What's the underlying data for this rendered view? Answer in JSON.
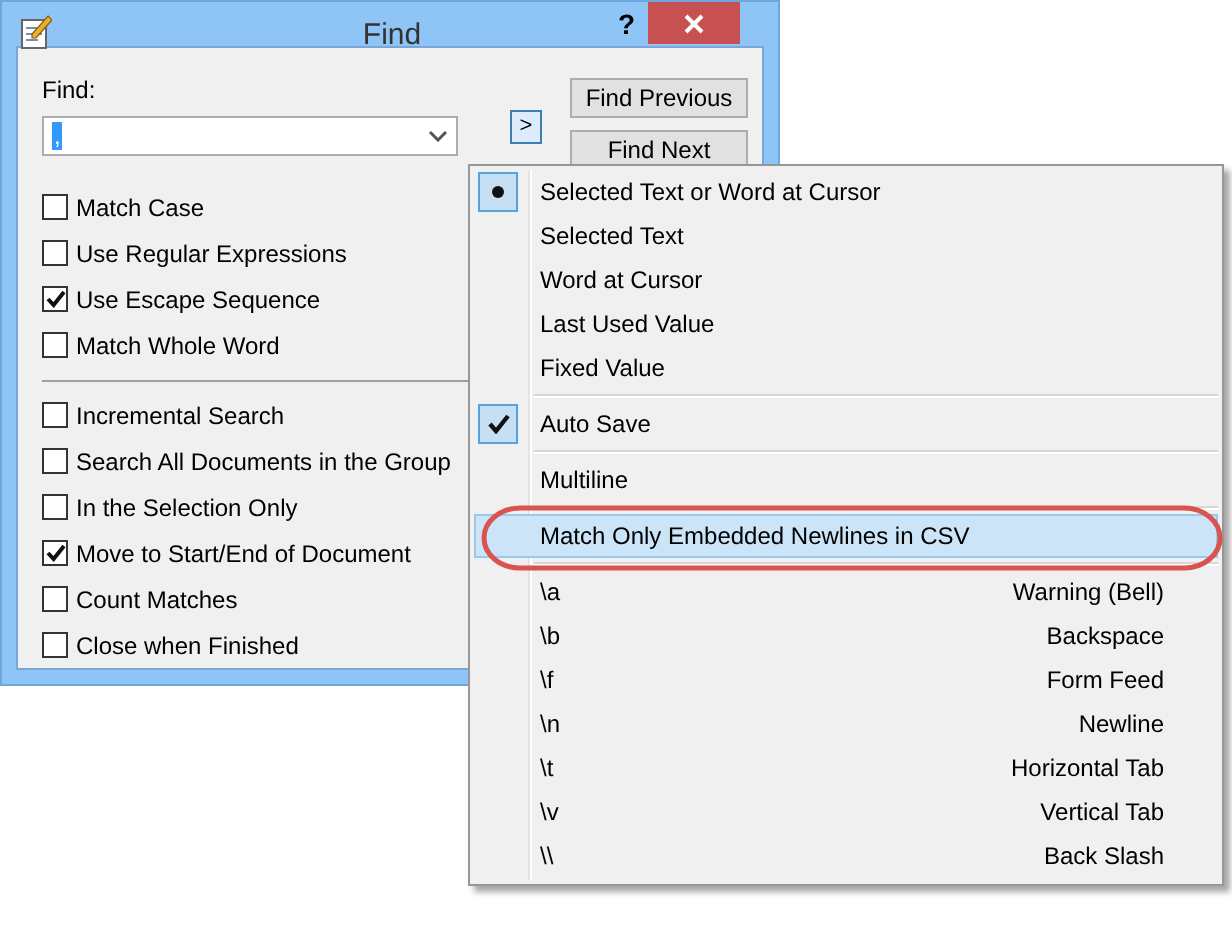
{
  "window": {
    "title": "Find",
    "help": "?"
  },
  "find": {
    "label": "Find:",
    "value": ",",
    "value_selected": true
  },
  "expand_button": {
    "label": ">",
    "pressed": true
  },
  "buttons": [
    {
      "label": "Find Previous"
    },
    {
      "label": "Find Next"
    }
  ],
  "option_groups": [
    [
      {
        "label": "Match Case",
        "checked": false
      },
      {
        "label": "Use Regular Expressions",
        "checked": false
      },
      {
        "label": "Use Escape Sequence",
        "checked": true
      },
      {
        "label": "Match Whole Word",
        "checked": false
      }
    ],
    [
      {
        "label": "Incremental Search",
        "checked": false
      },
      {
        "label": "Search All Documents in the Group",
        "checked": false
      },
      {
        "label": "In the Selection Only",
        "checked": false
      },
      {
        "label": "Move to Start/End of Document",
        "checked": true
      },
      {
        "label": "Count Matches",
        "checked": false
      },
      {
        "label": "Close when Finished",
        "checked": false
      }
    ]
  ],
  "menu": {
    "items": [
      {
        "kind": "radio",
        "label": "Selected Text or Word at Cursor",
        "selected": true
      },
      {
        "kind": "radio",
        "label": "Selected Text",
        "selected": false
      },
      {
        "kind": "radio",
        "label": "Word at Cursor",
        "selected": false
      },
      {
        "kind": "radio",
        "label": "Last Used Value",
        "selected": false
      },
      {
        "kind": "radio",
        "label": "Fixed Value",
        "selected": false
      },
      {
        "kind": "separator"
      },
      {
        "kind": "check",
        "label": "Auto Save",
        "checked": true,
        "highlighted": false,
        "circled": false
      },
      {
        "kind": "separator"
      },
      {
        "kind": "check",
        "label": "Multiline",
        "checked": false,
        "highlighted": false,
        "circled": false
      },
      {
        "kind": "separator"
      },
      {
        "kind": "check",
        "label": "Match Only Embedded Newlines in CSV",
        "checked": false,
        "highlighted": true,
        "circled": true
      },
      {
        "kind": "separator"
      },
      {
        "kind": "escape",
        "code": "\\a",
        "description": "Warning (Bell)"
      },
      {
        "kind": "escape",
        "code": "\\b",
        "description": "Backspace"
      },
      {
        "kind": "escape",
        "code": "\\f",
        "description": "Form Feed"
      },
      {
        "kind": "escape",
        "code": "\\n",
        "description": "Newline"
      },
      {
        "kind": "escape",
        "code": "\\t",
        "description": "Horizontal Tab"
      },
      {
        "kind": "escape",
        "code": "\\v",
        "description": "Vertical Tab"
      },
      {
        "kind": "escape",
        "code": "\\\\",
        "description": "Back Slash"
      }
    ]
  }
}
